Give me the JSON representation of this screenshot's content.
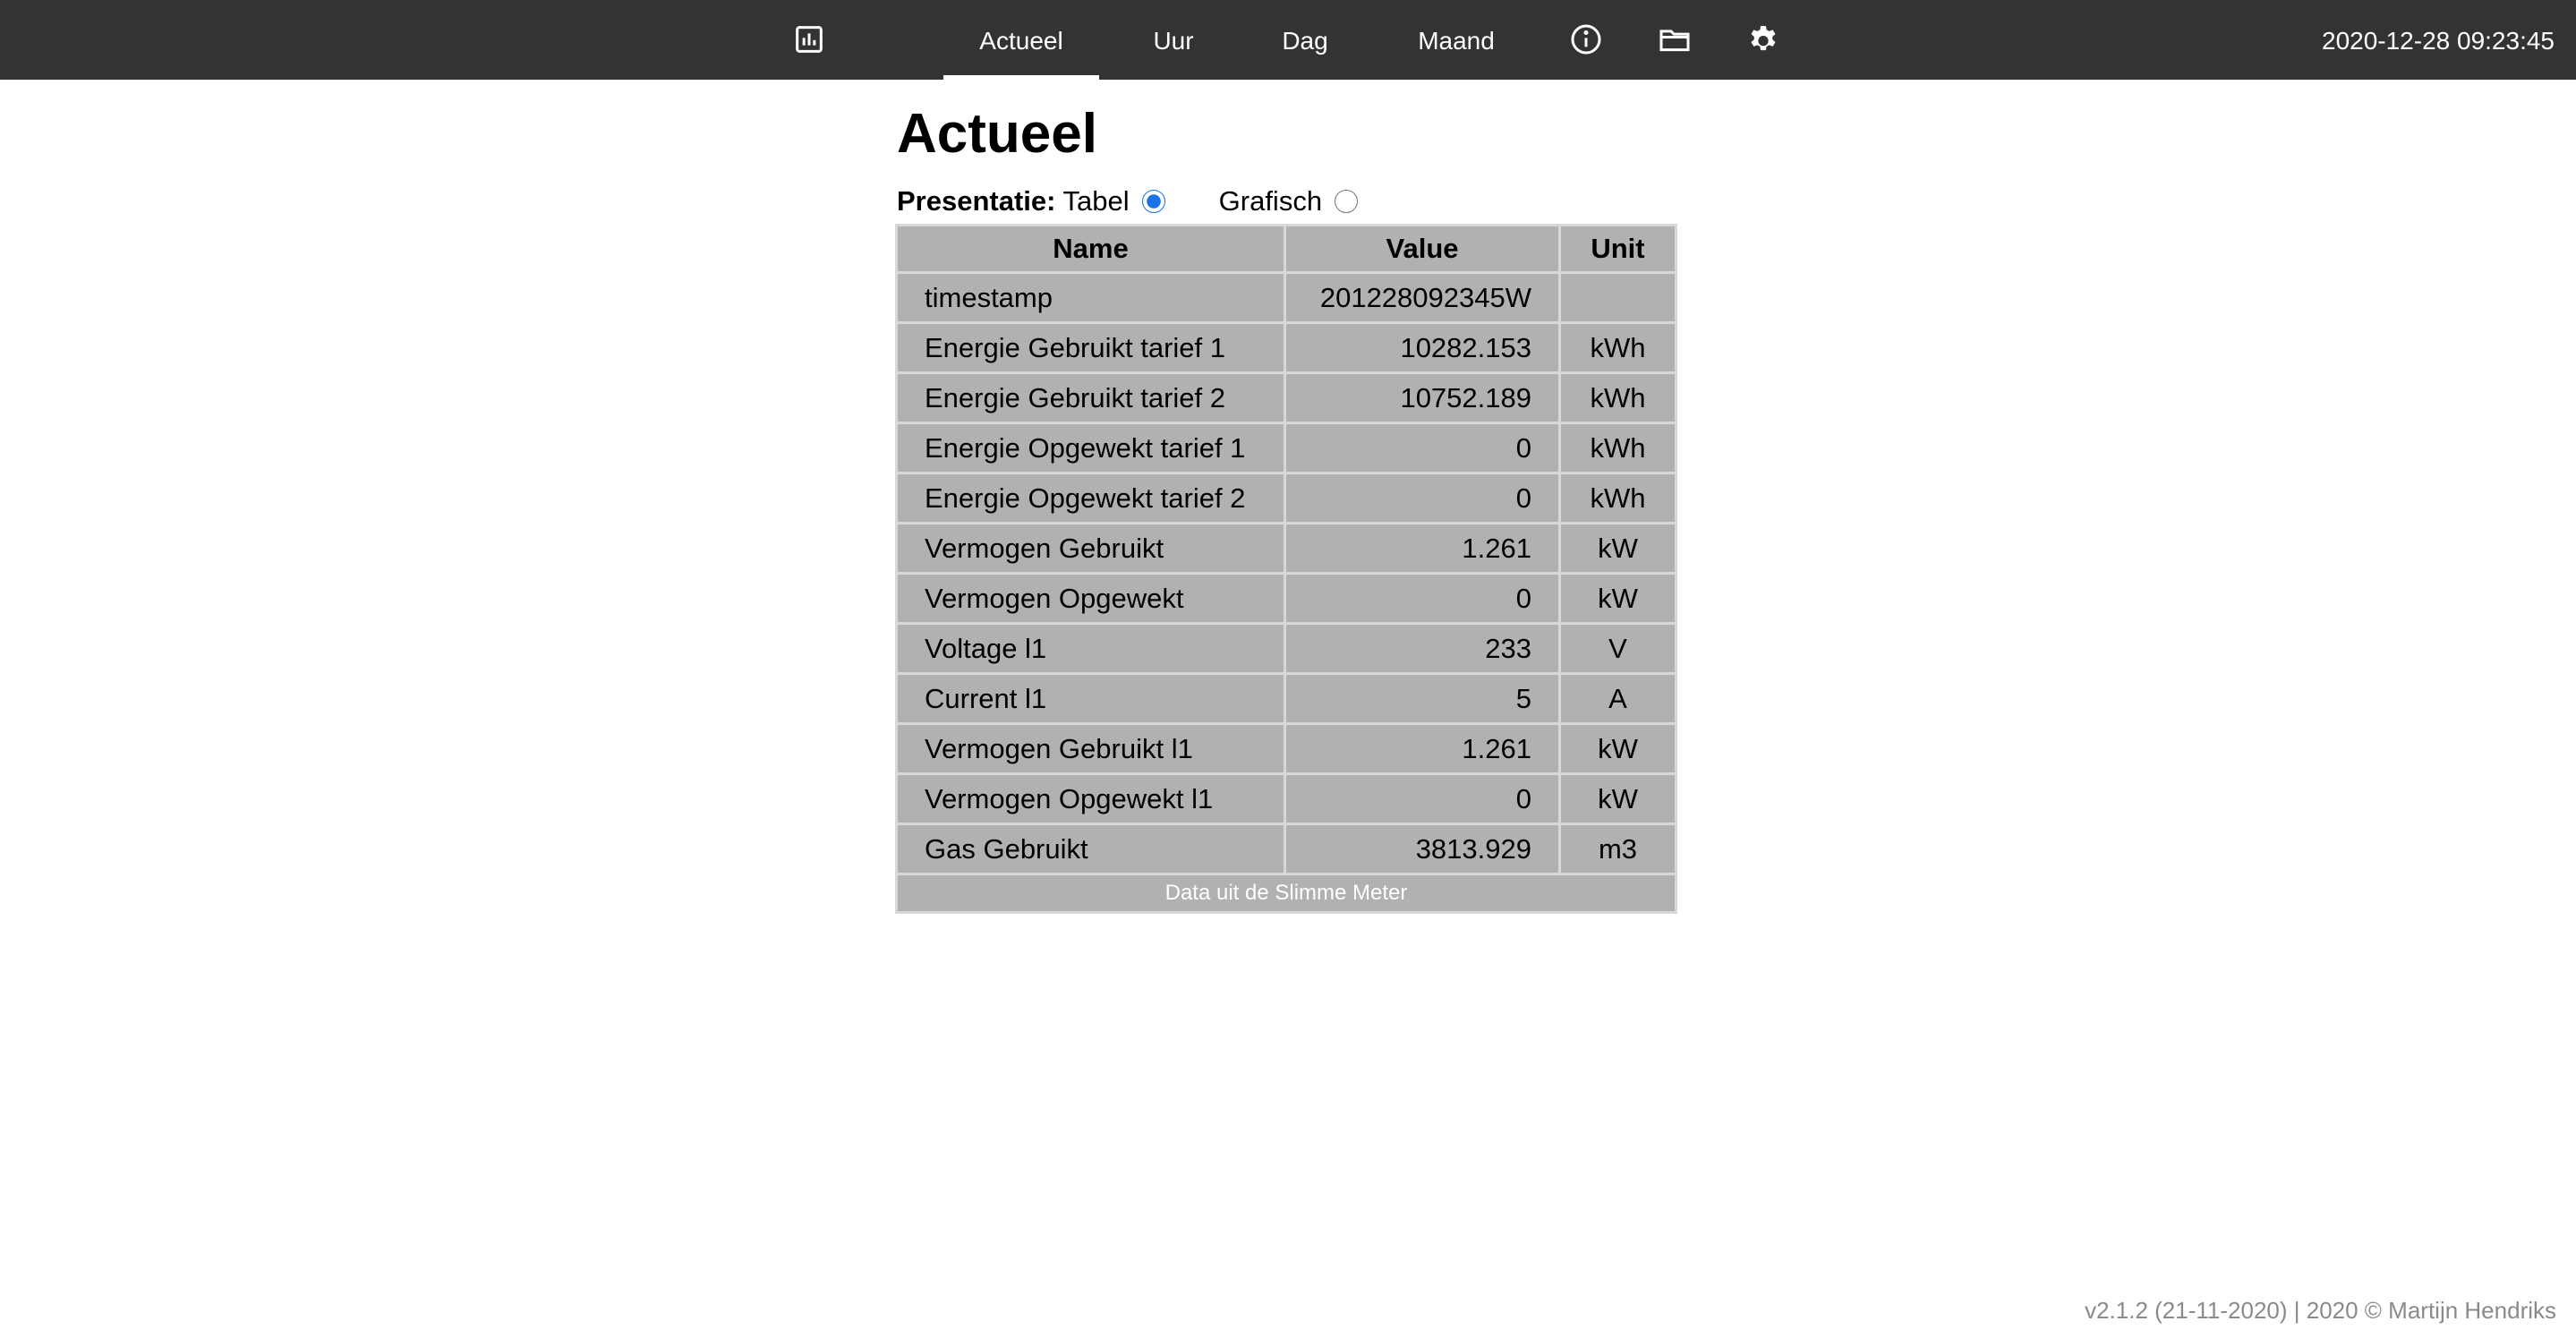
{
  "nav": {
    "tabs": [
      {
        "label": "Actueel",
        "active": true
      },
      {
        "label": "Uur",
        "active": false
      },
      {
        "label": "Dag",
        "active": false
      },
      {
        "label": "Maand",
        "active": false
      }
    ],
    "icons": [
      "bar-chart-icon",
      "info-icon",
      "folder-icon",
      "gear-icon"
    ],
    "datetime": "2020-12-28 09:23:45"
  },
  "page": {
    "title": "Actueel",
    "presentation_label": "Presentatie:",
    "options": [
      {
        "label": "Tabel",
        "selected": true
      },
      {
        "label": "Grafisch",
        "selected": false
      }
    ]
  },
  "table": {
    "headers": [
      "Name",
      "Value",
      "Unit"
    ],
    "rows": [
      {
        "name": "timestamp",
        "value": "201228092345W",
        "unit": ""
      },
      {
        "name": "Energie Gebruikt tarief 1",
        "value": "10282.153",
        "unit": "kWh"
      },
      {
        "name": "Energie Gebruikt tarief 2",
        "value": "10752.189",
        "unit": "kWh"
      },
      {
        "name": "Energie Opgewekt tarief 1",
        "value": "0",
        "unit": "kWh"
      },
      {
        "name": "Energie Opgewekt tarief 2",
        "value": "0",
        "unit": "kWh"
      },
      {
        "name": "Vermogen Gebruikt",
        "value": "1.261",
        "unit": "kW"
      },
      {
        "name": "Vermogen Opgewekt",
        "value": "0",
        "unit": "kW"
      },
      {
        "name": "Voltage l1",
        "value": "233",
        "unit": "V"
      },
      {
        "name": "Current l1",
        "value": "5",
        "unit": "A"
      },
      {
        "name": "Vermogen Gebruikt l1",
        "value": "1.261",
        "unit": "kW"
      },
      {
        "name": "Vermogen Opgewekt l1",
        "value": "0",
        "unit": "kW"
      },
      {
        "name": "Gas Gebruikt",
        "value": "3813.929",
        "unit": "m3"
      }
    ],
    "caption": "Data uit de Slimme Meter"
  },
  "footer": {
    "text": "v2.1.2 (21-11-2020) | 2020 © Martijn Hendriks"
  },
  "colors": {
    "topbar": "#333333",
    "cell": "#b1b1b1",
    "footer_text": "#8a8a8a"
  }
}
